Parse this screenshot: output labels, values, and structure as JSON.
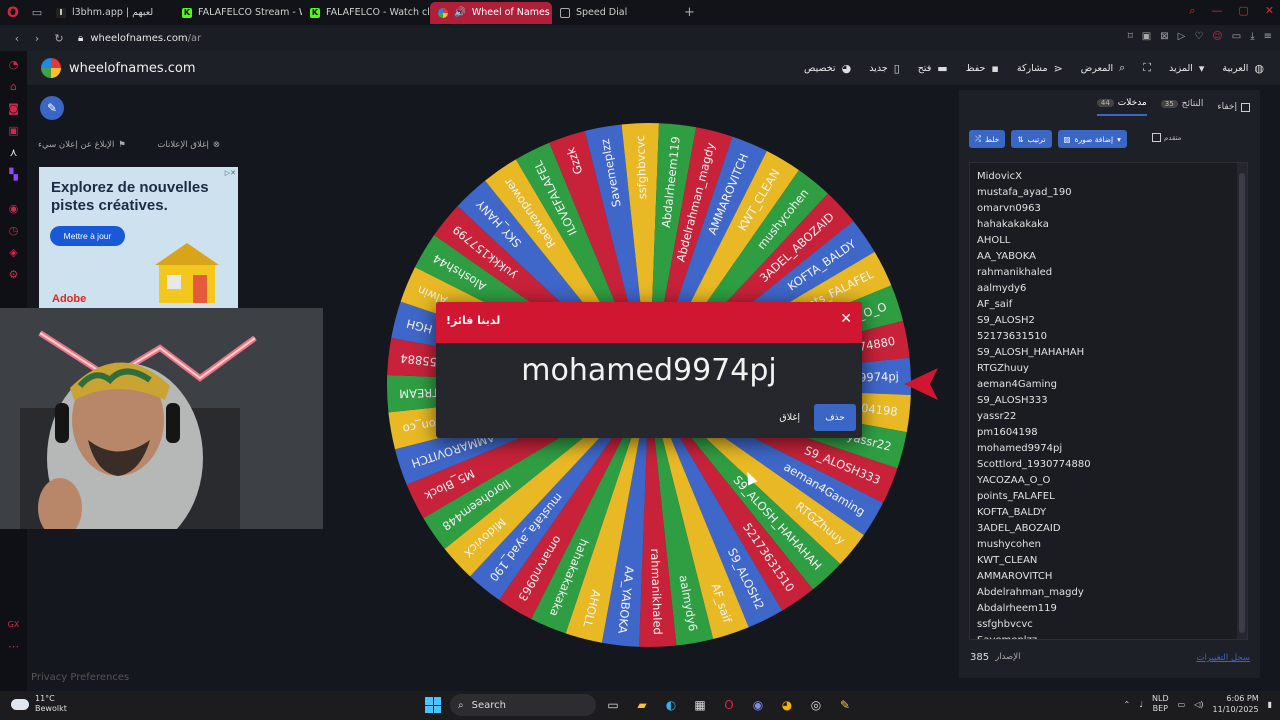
{
  "browser": {
    "tabs": [
      {
        "label": "l3bhm.app | لعبهم",
        "active": false
      },
      {
        "label": "FALAFELCO Stream - Wat",
        "active": false
      },
      {
        "label": "FALAFELCO - Watch clip",
        "active": false
      },
      {
        "label": "Wheel of Names | عجلة",
        "active": true
      },
      {
        "label": "Speed Dial",
        "active": false
      }
    ],
    "url_host": "wheelofnames.com",
    "url_path": "/ar"
  },
  "site": {
    "name": "wheelofnames.com",
    "menu": [
      {
        "label": "العربية",
        "icon": "globe-icon"
      },
      {
        "label": "المزيد",
        "icon": "chevron-down-icon"
      },
      {
        "label": "",
        "icon": "fullscreen-icon"
      },
      {
        "label": "المعرض",
        "icon": "search-icon"
      },
      {
        "label": "مشاركة",
        "icon": "share-icon"
      },
      {
        "label": "حفظ",
        "icon": "save-icon"
      },
      {
        "label": "فتح",
        "icon": "folder-icon"
      },
      {
        "label": "جديد",
        "icon": "new-file-icon"
      },
      {
        "label": "تخصيص",
        "icon": "palette-icon"
      }
    ]
  },
  "ad": {
    "report_label": "الإبلاغ عن إعلان سيء",
    "close_label": "إغلاق الإعلانات",
    "headline": "Explorez de nouvelles pistes créatives.",
    "button": "Mettre à jour",
    "brand": "Adobe"
  },
  "privacy": "Privacy Preferences",
  "wheel": {
    "colors": [
      "#3f67c9",
      "#e8b924",
      "#2f9e43",
      "#c8223a"
    ],
    "segments": [
      "mohamed9974pj",
      "pm1604198",
      "yassr22",
      "S9_ALOSH333",
      "aeman4Gaming",
      "RTGZhuuy",
      "S9_ALOSH_HAHAHAH",
      "52173631510",
      "S9_ALOSH2",
      "AF_saif",
      "aalmydy6",
      "rahmanikhaled",
      "AA_YABOKA",
      "AHOLL",
      "hahakakakaka",
      "omarvn0963",
      "mustafa_ayad_190",
      "MidovicX",
      "lloroheem448",
      "M5_Block",
      "AMMAROVITCH",
      "moon_co",
      "ALSTREAM",
      "55884",
      "HGH",
      "Alwin",
      "Aloshsh44",
      "yukkk157799",
      "SKY_HANY",
      "Radwanpower",
      "ILOVEFALAFEL",
      "Gzzk",
      "Savemeplzz",
      "ssfghbvcvc",
      "Abdalrheem119",
      "Abdelrahman_magdy",
      "AMMAROVITCH",
      "KWT_CLEAN",
      "mushycohen",
      "3ADEL_ABOZAID",
      "KOFTA_BALDY",
      "points_FALAFEL",
      "YACOZAA_O_O",
      "Scottlord_1930774880"
    ]
  },
  "panel": {
    "tabs": [
      {
        "label": "مدخلات",
        "count": "44",
        "active": true
      },
      {
        "label": "النتائج",
        "count": "35",
        "active": false
      }
    ],
    "hide_label": "إخفاء",
    "toolbar": {
      "shuffle": "خلط",
      "sort": "ترتيب",
      "add_image": "إضافة صورة",
      "advanced": "متقدم"
    },
    "entries": [
      "MidovicX",
      "mustafa_ayad_190",
      "omarvn0963",
      "hahakakakaka",
      "AHOLL",
      "AA_YABOKA",
      "rahmanikhaled",
      "aalmydy6",
      "AF_saif",
      "S9_ALOSH2",
      "52173631510",
      "S9_ALOSH_HAHAHAH",
      "RTGZhuuy",
      "aeman4Gaming",
      "S9_ALOSH333",
      "yassr22",
      "pm1604198",
      "mohamed9974pj",
      "Scottlord_1930774880",
      "YACOZAA_O_O",
      "points_FALAFEL",
      "KOFTA_BALDY",
      "3ADEL_ABOZAID",
      "mushycohen",
      "KWT_CLEAN",
      "AMMAROVITCH",
      "Abdelrahman_magdy",
      "Abdalrheem119",
      "ssfghbvcvc",
      "Savemeplzz"
    ],
    "version_label": "الإصدار",
    "version": "385",
    "changelog": "سجل التغييرات"
  },
  "dialog": {
    "title": "لدينا فائز!",
    "winner": "mohamed9974pj",
    "close_label": "إغلاق",
    "remove_label": "حذف"
  },
  "taskbar": {
    "temp": "11°C",
    "weather": "Bewolkt",
    "search": "Search",
    "lang1": "NLD",
    "lang2": "BEP",
    "time": "6:06 PM",
    "date": "11/10/2025"
  }
}
